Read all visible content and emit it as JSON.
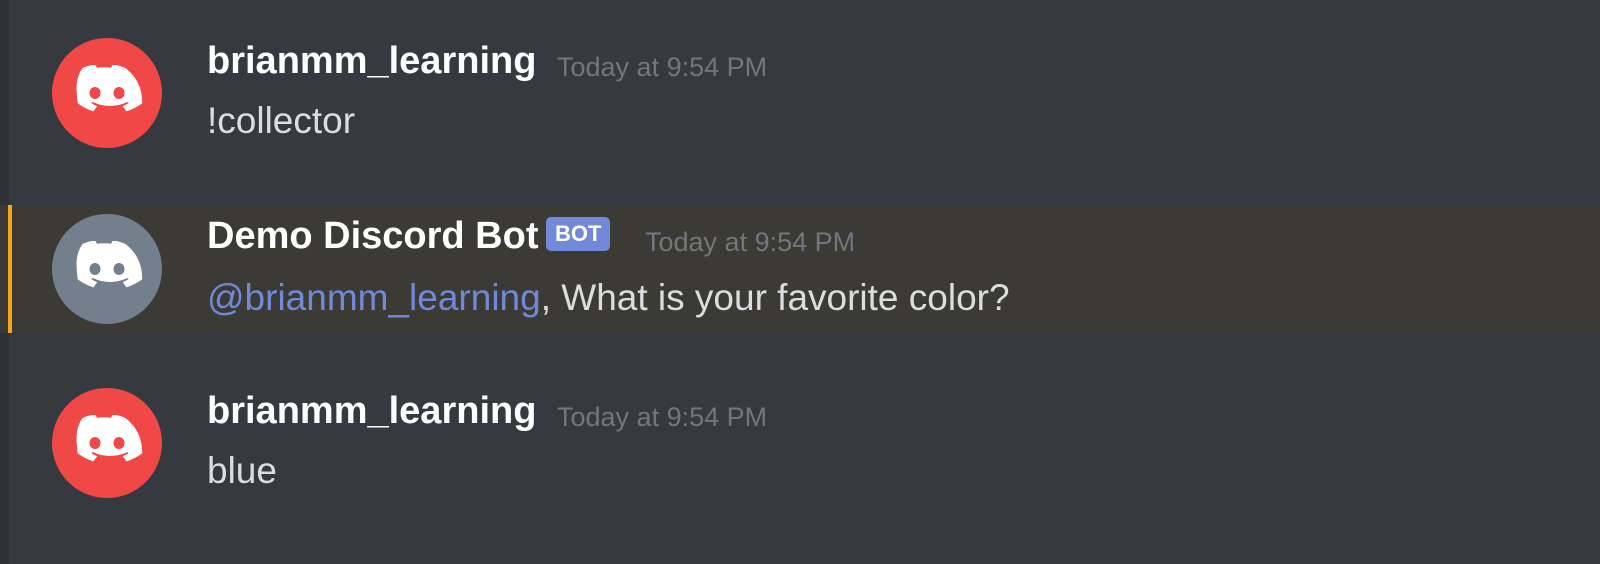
{
  "colors": {
    "background": "#36393f",
    "avatar_user": "#f04747",
    "avatar_bot": "#747f8d",
    "mention": "#7289da",
    "bot_tag": "#7289da",
    "highlight_bar": "#faa61a"
  },
  "messages": [
    {
      "avatar_icon": "discord-logo-icon",
      "username": "brianmm_learning",
      "timestamp": "Today at 9:54 PM",
      "text": "!collector"
    },
    {
      "avatar_icon": "discord-logo-icon",
      "username": "Demo Discord Bot",
      "bot_tag": "BOT",
      "timestamp": "Today at 9:54 PM",
      "mention": "@brianmm_learning",
      "text": ", What is your favorite color?"
    },
    {
      "avatar_icon": "discord-logo-icon",
      "username": "brianmm_learning",
      "timestamp": "Today at 9:54 PM",
      "text": "blue"
    }
  ]
}
